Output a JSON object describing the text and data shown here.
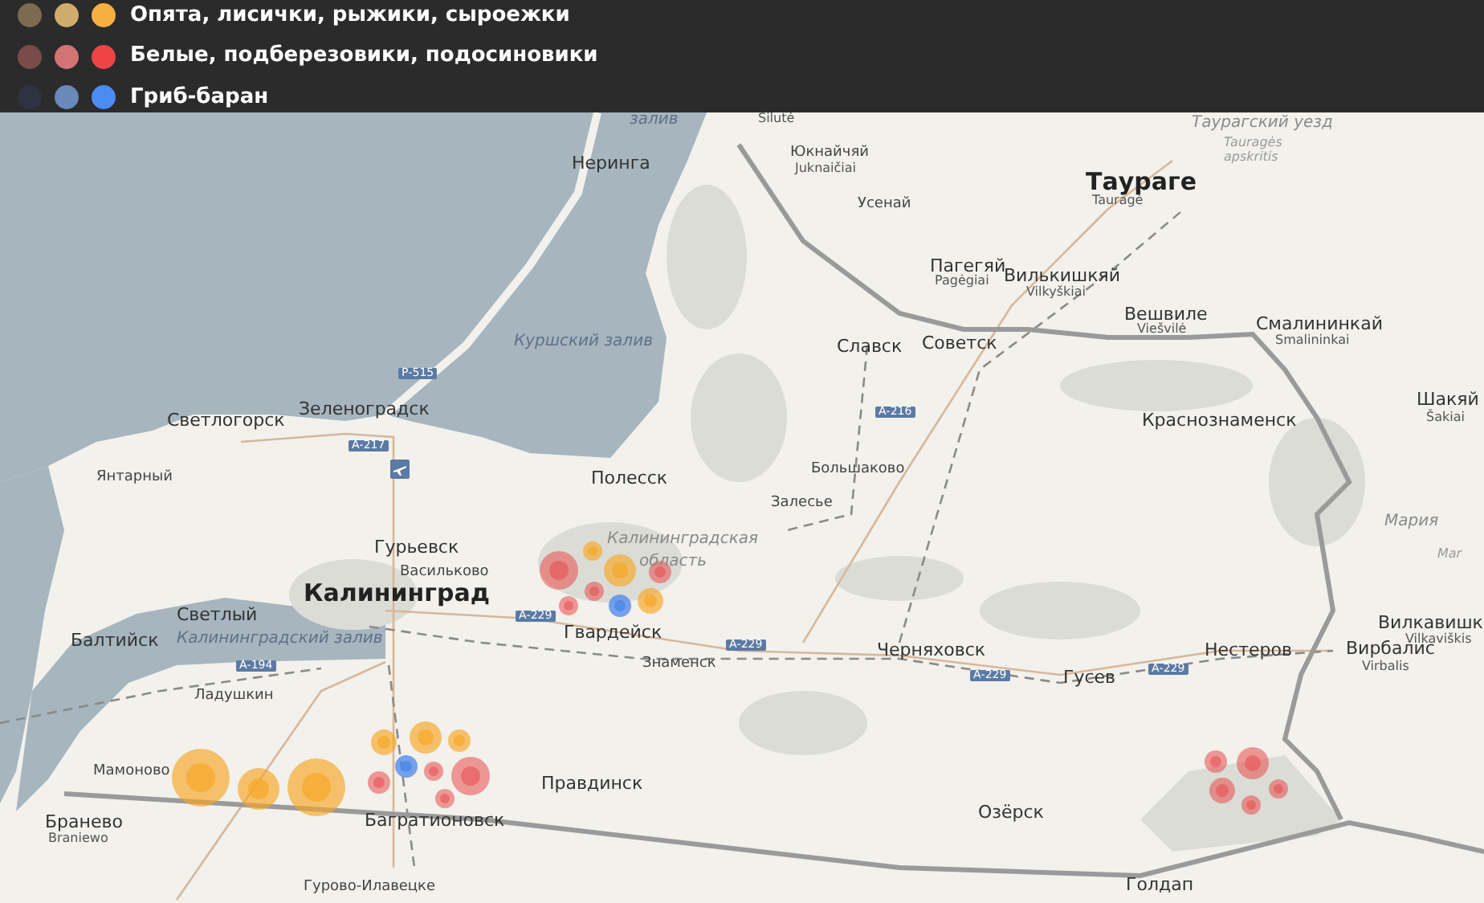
{
  "legend": [
    {
      "label": "Опята, лисички, рыжики, сыроежки",
      "dots": [
        {
          "color": "#7d6b4f"
        },
        {
          "color": "#cfab6c"
        },
        {
          "color": "#f6b042"
        }
      ]
    },
    {
      "label": "Белые, подберезовики, подосиновики",
      "dots": [
        {
          "color": "#7a4b4b"
        },
        {
          "color": "#d27476"
        },
        {
          "color": "#ee4445"
        }
      ]
    },
    {
      "label": "Гриб-баран",
      "dots": [
        {
          "color": "#2d3340"
        },
        {
          "color": "#6a88b9"
        },
        {
          "color": "#4c8bf2"
        }
      ]
    }
  ],
  "map": {
    "labels": [
      {
        "text": "залив",
        "kind": "water"
      },
      {
        "text": "Неринга",
        "kind": "city"
      },
      {
        "text": "Куршский залив",
        "kind": "water"
      },
      {
        "text": "Р-515",
        "kind": "road"
      },
      {
        "text": "Светлогорск",
        "kind": "city"
      },
      {
        "text": "Зеленоградск",
        "kind": "city"
      },
      {
        "text": "А-217",
        "kind": "road"
      },
      {
        "text": "Янтарный",
        "kind": "town"
      },
      {
        "text": "Полесск",
        "kind": "city"
      },
      {
        "text": "Šilutė",
        "kind": "sub"
      },
      {
        "text": "Юкнайчяй",
        "kind": "town"
      },
      {
        "text": "Juknaičiai",
        "kind": "sub"
      },
      {
        "text": "Усенай",
        "kind": "town"
      },
      {
        "text": "Таурагский уезд",
        "kind": "region"
      },
      {
        "text": "Tauragės",
        "kind": "region-sub"
      },
      {
        "text": "apskritis",
        "kind": "region-sub"
      },
      {
        "text": "Таураге",
        "kind": "big"
      },
      {
        "text": "Tauragė",
        "kind": "sub"
      },
      {
        "text": "Пагегяй",
        "kind": "city"
      },
      {
        "text": "Pagėgiai",
        "kind": "sub"
      },
      {
        "text": "Вилькишкяй",
        "kind": "city"
      },
      {
        "text": "Vilkyškiai",
        "kind": "sub"
      },
      {
        "text": "Вешвиле",
        "kind": "city"
      },
      {
        "text": "Viešvilė",
        "kind": "sub"
      },
      {
        "text": "Смалининкай",
        "kind": "city"
      },
      {
        "text": "Smalininkai",
        "kind": "sub"
      },
      {
        "text": "Славск",
        "kind": "city"
      },
      {
        "text": "Советск",
        "kind": "city"
      },
      {
        "text": "А-216",
        "kind": "road"
      },
      {
        "text": "Краснознаменск",
        "kind": "city"
      },
      {
        "text": "Шакяй",
        "kind": "city"
      },
      {
        "text": "Šakiai",
        "kind": "sub"
      },
      {
        "text": "Большаково",
        "kind": "town"
      },
      {
        "text": "Залесье",
        "kind": "town"
      },
      {
        "text": "Калининградская",
        "kind": "region"
      },
      {
        "text": "область",
        "kind": "region"
      },
      {
        "text": "Гурьевск",
        "kind": "city"
      },
      {
        "text": "Васильково",
        "kind": "town"
      },
      {
        "text": "Калининград",
        "kind": "big"
      },
      {
        "text": "А-229",
        "kind": "road"
      },
      {
        "text": "Гвардейск",
        "kind": "city"
      },
      {
        "text": "Светлый",
        "kind": "city"
      },
      {
        "text": "Балтийск",
        "kind": "city"
      },
      {
        "text": "Калининградский залив",
        "kind": "water"
      },
      {
        "text": "А-194",
        "kind": "road"
      },
      {
        "text": "Знаменск",
        "kind": "town"
      },
      {
        "text": "А-229",
        "kind": "road"
      },
      {
        "text": "Ладушкин",
        "kind": "town"
      },
      {
        "text": "Мария",
        "kind": "region"
      },
      {
        "text": "Mar",
        "kind": "region-sub"
      },
      {
        "text": "Вилкавишк",
        "kind": "city"
      },
      {
        "text": "Vilkaviškis",
        "kind": "sub"
      },
      {
        "text": "Вирбалис",
        "kind": "city"
      },
      {
        "text": "Virbalis",
        "kind": "sub"
      },
      {
        "text": "Черняховск",
        "kind": "city"
      },
      {
        "text": "Нестеров",
        "kind": "city"
      },
      {
        "text": "А-229",
        "kind": "road"
      },
      {
        "text": "А-229",
        "kind": "road"
      },
      {
        "text": "Гусев",
        "kind": "city"
      },
      {
        "text": "Мамоново",
        "kind": "town"
      },
      {
        "text": "Правдинск",
        "kind": "city"
      },
      {
        "text": "Бранево",
        "kind": "city"
      },
      {
        "text": "Braniewo",
        "kind": "sub"
      },
      {
        "text": "Багратионовск",
        "kind": "city"
      },
      {
        "text": "Озёрск",
        "kind": "city"
      },
      {
        "text": "Голдап",
        "kind": "city"
      },
      {
        "text": "Гурово-Илавецке",
        "kind": "town"
      }
    ]
  }
}
